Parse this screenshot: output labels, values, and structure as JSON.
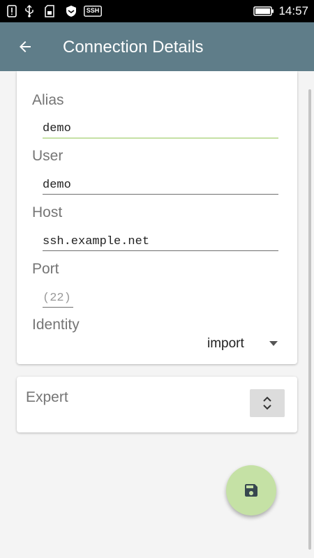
{
  "status_bar": {
    "time": "14:57",
    "icons": [
      "sim-alert-icon",
      "usb-icon",
      "sd-card-icon",
      "shield-icon",
      "ssh-badge-icon",
      "battery-icon"
    ],
    "ssh_badge_text": "SSH"
  },
  "toolbar": {
    "title": "Connection Details",
    "back_icon": "arrow-left-icon"
  },
  "form": {
    "alias_label": "Alias",
    "alias_value": "demo",
    "user_label": "User",
    "user_value": "demo",
    "host_label": "Host",
    "host_value": "ssh.example.net",
    "port_label": "Port",
    "port_placeholder": "(22)",
    "identity_label": "Identity",
    "identity_value": "import"
  },
  "expert": {
    "label": "Expert",
    "expand_icon": "unfold-more-icon"
  },
  "fab": {
    "icon": "save-floppy-icon"
  },
  "colors": {
    "toolbar": "#5f7d89",
    "accent": "#c5e1a5",
    "fab_icon": "#37474f"
  }
}
